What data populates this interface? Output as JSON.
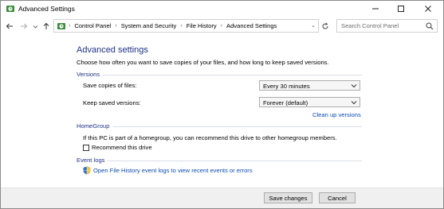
{
  "window": {
    "title": "Advanced Settings",
    "app_icon": "file-history-icon",
    "controls": {
      "minimize": "minimize-icon",
      "maximize": "maximize-icon",
      "close": "close-icon"
    }
  },
  "nav": {
    "back": "back-arrow-icon",
    "forward": "forward-arrow-icon",
    "recent": "chevron-down-icon",
    "up": "up-arrow-icon",
    "breadcrumbs": [
      "Control Panel",
      "System and Security",
      "File History",
      "Advanced Settings"
    ],
    "search_placeholder": "Search Control Panel"
  },
  "main": {
    "heading": "Advanced settings",
    "description": "Choose how often you want to save copies of your files, and how long to keep saved versions.",
    "versions": {
      "section_label": "Versions",
      "save_copies_label": "Save copies of files:",
      "save_copies_value": "Every 30 minutes",
      "keep_versions_label": "Keep saved versions:",
      "keep_versions_value": "Forever (default)",
      "cleanup_link": "Clean up versions"
    },
    "homegroup": {
      "section_label": "HomeGroup",
      "description": "If this PC is part of a homegroup, you can recommend this drive to other homegroup members.",
      "recommend_label": "Recommend this drive",
      "recommend_checked": false
    },
    "event_logs": {
      "section_label": "Event logs",
      "link": "Open File History event logs to view recent events or errors"
    }
  },
  "footer": {
    "save_label": "Save changes",
    "cancel_label": "Cancel"
  },
  "colors": {
    "heading": "#1e3287",
    "link": "#0b4cb4",
    "footer_bg": "#f0f0f0"
  }
}
